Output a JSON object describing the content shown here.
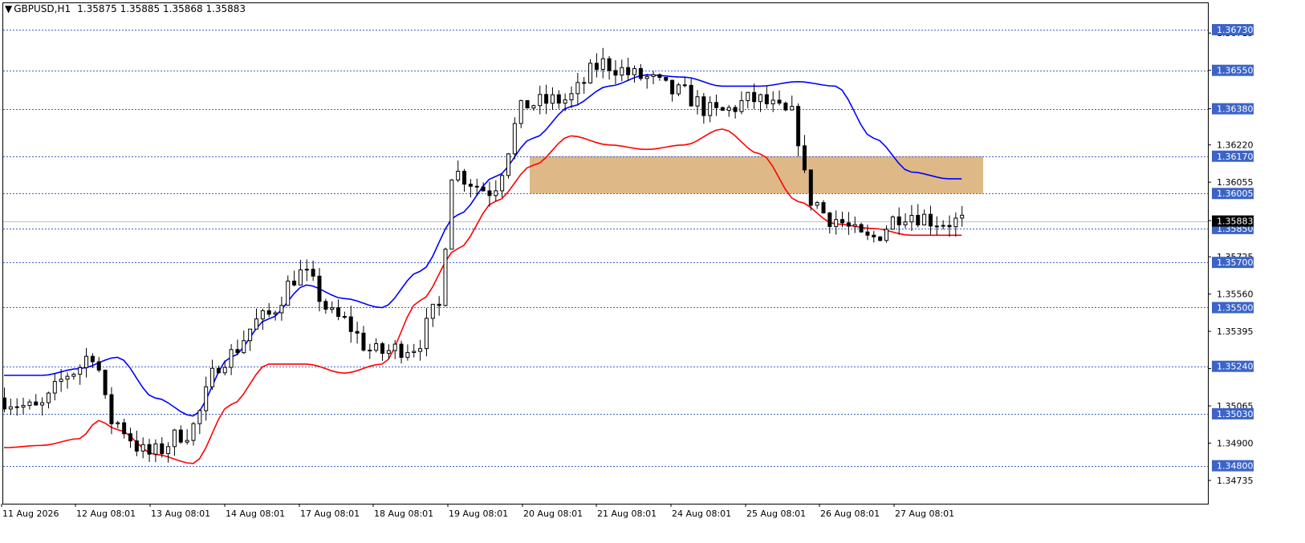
{
  "header": {
    "arrow": "▼",
    "symbol": "GBPUSD,H1",
    "ohlc": "1.35875 1.35885 1.35868 1.35883"
  },
  "colors": {
    "candle": "#000000",
    "ma_fast": "#0000ff",
    "ma_slow": "#ff0000",
    "level_line": "#3c64c8",
    "level_badge": "#3c64c8",
    "zone_fill": "#deb887",
    "price_badge": "#000000",
    "bid_line": "#c0c0c0"
  },
  "chart_data": {
    "type": "candlestick",
    "symbol": "GBPUSD",
    "timeframe": "H1",
    "ylim": [
      1.3465,
      1.3683
    ],
    "price_ticks": [
      "1.36715",
      "1.36550",
      "1.36380",
      "1.36220",
      "1.36055",
      "1.35885",
      "1.35725",
      "1.35560",
      "1.35395",
      "1.35230",
      "1.35065",
      "1.34900",
      "1.34735"
    ],
    "time_ticks": [
      "11 Aug 2026",
      "12 Aug 08:01",
      "13 Aug 08:01",
      "14 Aug 08:01",
      "17 Aug 08:01",
      "18 Aug 08:01",
      "19 Aug 08:01",
      "20 Aug 08:01",
      "21 Aug 08:01",
      "24 Aug 08:01",
      "25 Aug 08:01",
      "26 Aug 08:01",
      "27 Aug 08:01"
    ],
    "horizontal_levels": [
      "1.36730",
      "1.36550",
      "1.36380",
      "1.36170",
      "1.36005",
      "1.35850",
      "1.35700",
      "1.35500",
      "1.35240",
      "1.35030",
      "1.34800"
    ],
    "current_price": "1.35883",
    "zone": {
      "from": 1.36005,
      "to": 1.3617
    },
    "ma_fast_anchors": [
      [
        0,
        1.352
      ],
      [
        6,
        1.352
      ],
      [
        12,
        1.3523
      ],
      [
        18,
        1.3528
      ],
      [
        24,
        1.351
      ],
      [
        30,
        1.3502
      ],
      [
        36,
        1.3528
      ],
      [
        42,
        1.3545
      ],
      [
        48,
        1.356
      ],
      [
        54,
        1.3554
      ],
      [
        60,
        1.355
      ],
      [
        66,
        1.3566
      ],
      [
        72,
        1.3591
      ],
      [
        78,
        1.3608
      ],
      [
        84,
        1.3625
      ],
      [
        90,
        1.3639
      ],
      [
        96,
        1.3648
      ],
      [
        102,
        1.3653
      ],
      [
        108,
        1.3652
      ],
      [
        114,
        1.3648
      ],
      [
        120,
        1.3648
      ],
      [
        126,
        1.365
      ],
      [
        132,
        1.3648
      ],
      [
        138,
        1.3625
      ],
      [
        144,
        1.361
      ],
      [
        150,
        1.3607
      ]
    ],
    "ma_slow_anchors": [
      [
        0,
        1.3488
      ],
      [
        6,
        1.3489
      ],
      [
        12,
        1.3492
      ],
      [
        15,
        1.35
      ],
      [
        18,
        1.3496
      ],
      [
        24,
        1.3485
      ],
      [
        30,
        1.3481
      ],
      [
        36,
        1.3507
      ],
      [
        42,
        1.3525
      ],
      [
        48,
        1.3525
      ],
      [
        54,
        1.3521
      ],
      [
        60,
        1.3525
      ],
      [
        66,
        1.3553
      ],
      [
        72,
        1.3576
      ],
      [
        78,
        1.3597
      ],
      [
        84,
        1.3613
      ],
      [
        90,
        1.3626
      ],
      [
        96,
        1.3622
      ],
      [
        102,
        1.362
      ],
      [
        108,
        1.3622
      ],
      [
        114,
        1.3629
      ],
      [
        120,
        1.3618
      ],
      [
        126,
        1.3597
      ],
      [
        132,
        1.3587
      ],
      [
        138,
        1.3585
      ],
      [
        144,
        1.3582
      ]
    ],
    "price_anchors": [
      [
        0,
        1.351
      ],
      [
        6,
        1.3505
      ],
      [
        12,
        1.3522
      ],
      [
        15,
        1.353
      ],
      [
        18,
        1.35
      ],
      [
        24,
        1.3485
      ],
      [
        30,
        1.3495
      ],
      [
        36,
        1.3528
      ],
      [
        42,
        1.3545
      ],
      [
        48,
        1.3565
      ],
      [
        54,
        1.3545
      ],
      [
        60,
        1.353
      ],
      [
        66,
        1.3533
      ],
      [
        70,
        1.355
      ],
      [
        72,
        1.361
      ],
      [
        78,
        1.3602
      ],
      [
        84,
        1.364
      ],
      [
        90,
        1.3642
      ],
      [
        96,
        1.3658
      ],
      [
        102,
        1.3652
      ],
      [
        108,
        1.3645
      ],
      [
        114,
        1.3636
      ],
      [
        120,
        1.3642
      ],
      [
        126,
        1.3635
      ],
      [
        129,
        1.3598
      ],
      [
        132,
        1.359
      ],
      [
        138,
        1.358
      ],
      [
        144,
        1.3592
      ],
      [
        150,
        1.3588
      ]
    ]
  }
}
